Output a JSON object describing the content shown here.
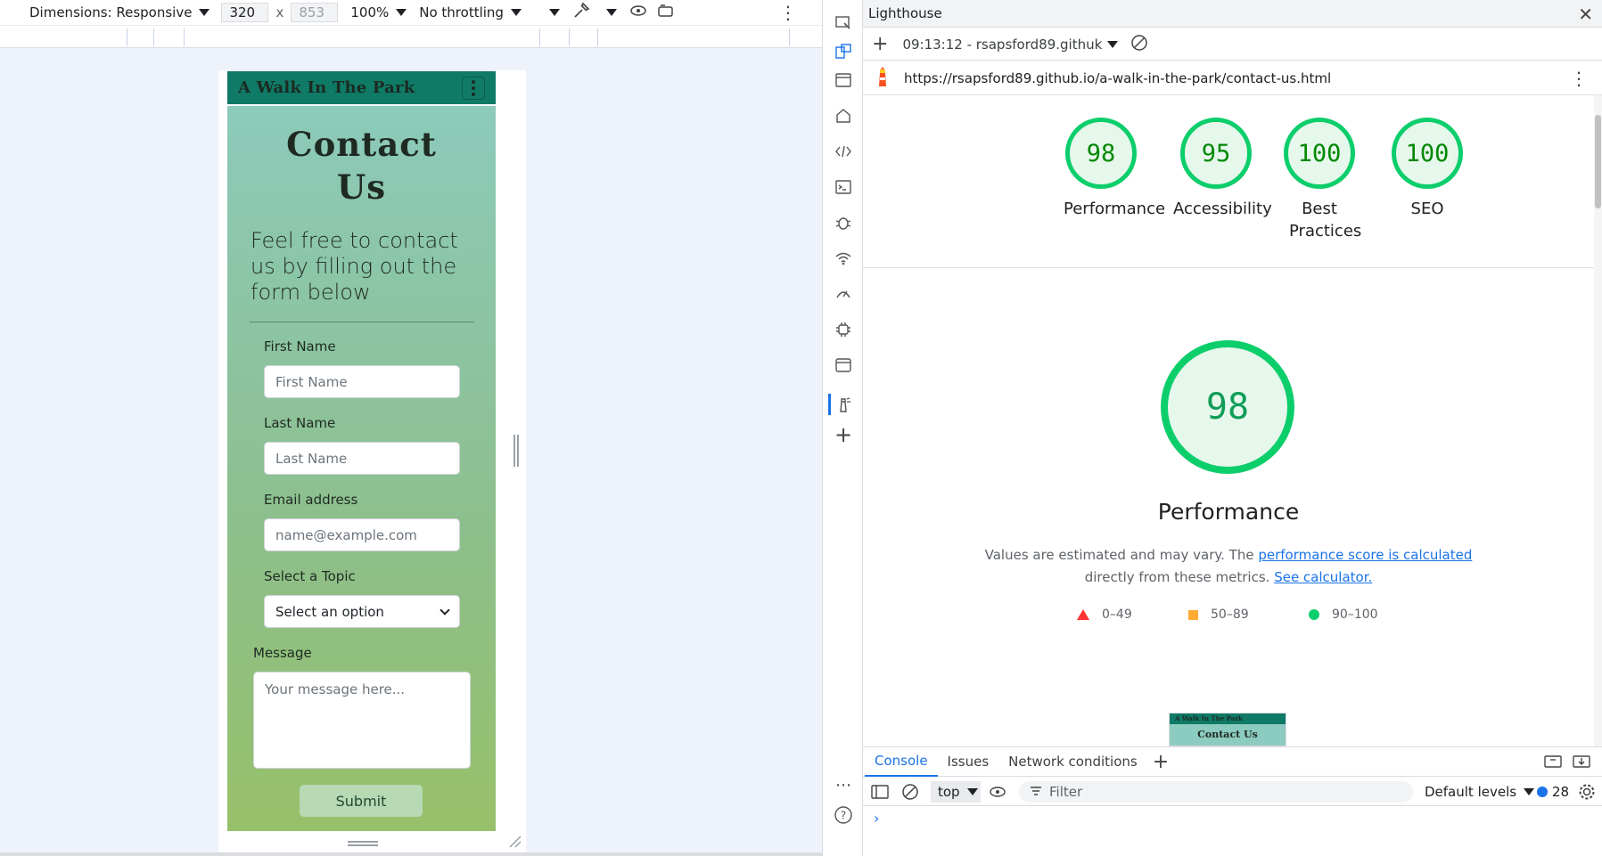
{
  "device_toolbar": {
    "dimensions_label": "Dimensions: Responsive",
    "width": "320",
    "times": "x",
    "height_placeholder": "853",
    "zoom": "100%",
    "throttling": "No throttling"
  },
  "site": {
    "brand": "A Walk In The Park",
    "page_title": "Contact Us",
    "lead": "Feel free to contact us by filling out the form below",
    "form": {
      "first_name_label": "First Name",
      "first_name_placeholder": "First Name",
      "last_name_label": "Last Name",
      "last_name_placeholder": "Last Name",
      "email_label": "Email address",
      "email_placeholder": "name@example.com",
      "topic_label": "Select a Topic",
      "topic_value": "Select an option",
      "message_label": "Message",
      "message_placeholder": "Your message here...",
      "submit_label": "Submit"
    }
  },
  "lighthouse": {
    "tab_title": "Lighthouse",
    "report_time": "09:13:12 - rsapsford89.githuk",
    "url": "https://rsapsford89.github.io/a-walk-in-the-park/contact-us.html",
    "scores": [
      {
        "value": "98",
        "label": "Performance"
      },
      {
        "value": "95",
        "label": "Accessibility"
      },
      {
        "value": "100",
        "label": "Best Practices"
      },
      {
        "value": "100",
        "label": "SEO"
      }
    ],
    "main_score": "98",
    "main_title": "Performance",
    "desc_prefix": "Values are estimated and may vary. The ",
    "desc_link1": "performance score is calculated",
    "desc_middle": "directly from these metrics. ",
    "desc_link2": "See calculator.",
    "legend": {
      "fail": "0–49",
      "average": "50–89",
      "pass": "90–100"
    },
    "thumb_brand": "A Walk In The Park",
    "thumb_title": "Contact Us",
    "colors": {
      "pass": "#0cce6b",
      "average": "#ffaa33",
      "fail": "#ff3333",
      "accent": "#1a73e8"
    }
  },
  "drawer": {
    "tabs": [
      "Console",
      "Issues",
      "Network conditions"
    ],
    "context": "top",
    "filter_placeholder": "Filter",
    "levels": "Default levels",
    "issue_count": "28"
  }
}
